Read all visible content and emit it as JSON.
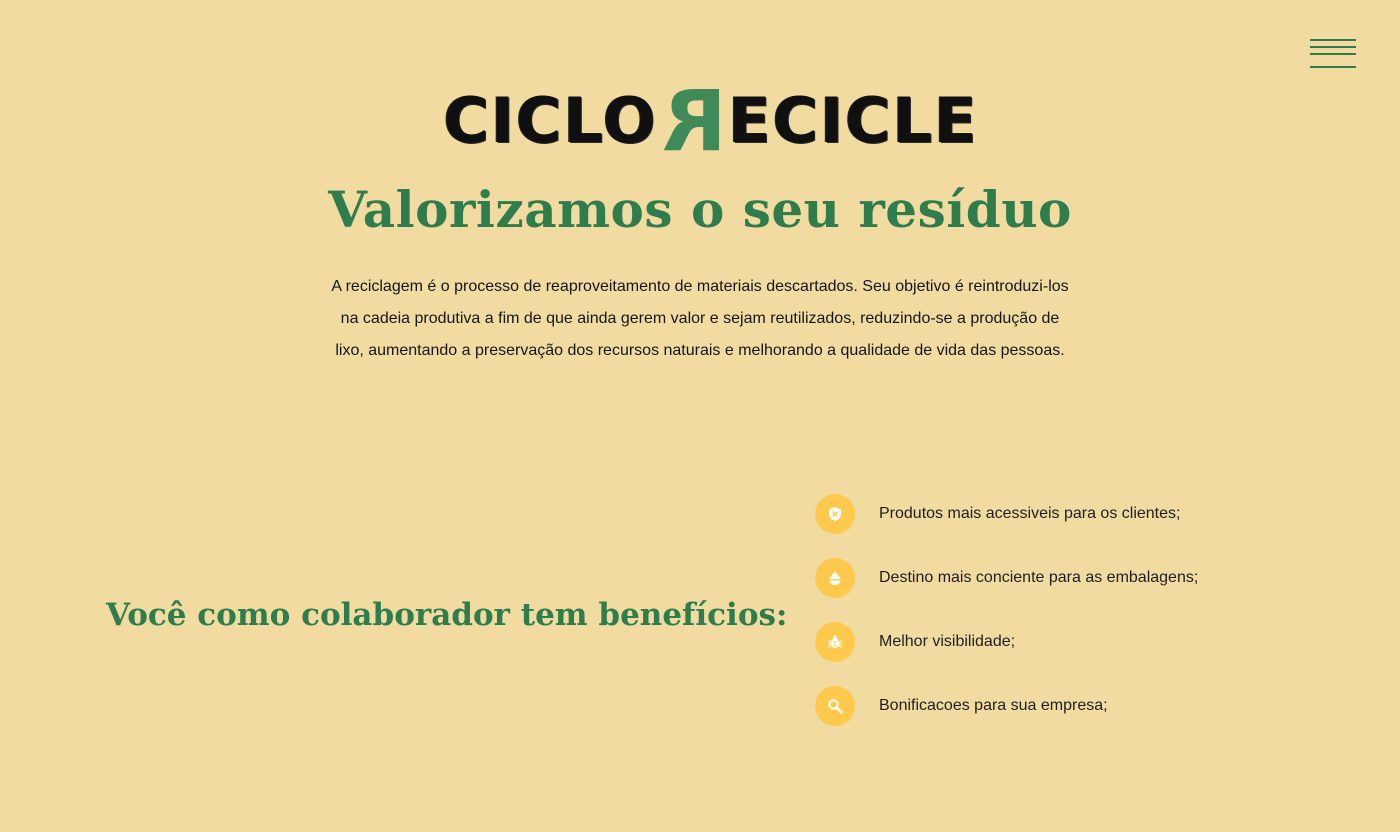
{
  "header": {
    "menu_icon": "hamburger-menu-icon"
  },
  "logo": {
    "text_left": "CICLO",
    "text_mark": "R",
    "text_right": "ECICLE"
  },
  "hero": {
    "title": "Valorizamos o seu resíduo",
    "description": "A reciclagem é o processo de reaproveitamento de materiais descartados. Seu objetivo é reintroduzi-los na cadeia produtiva a fim de que ainda gerem valor e sejam reutilizados, reduzindo-se a produção de lixo, aumentando a preservação dos recursos naturais e melhorando a qualidade de vida das pessoas."
  },
  "benefits": {
    "title": "Você como colaborador tem benefícios:",
    "items": [
      {
        "label": "Produtos mais acessiveis para os clientes;",
        "icon": "shield-icon"
      },
      {
        "label": "Destino mais conciente para as embalagens;",
        "icon": "drop-icon"
      },
      {
        "label": "Melhor visibilidade;",
        "icon": "bug-icon"
      },
      {
        "label": "Bonificacoes para sua empresa;",
        "icon": "search-icon"
      }
    ]
  },
  "colors": {
    "background": "#f1dba0",
    "primary_green": "#2f7c4c",
    "icon_yellow": "#fec94d",
    "text": "#1f1f1f"
  }
}
